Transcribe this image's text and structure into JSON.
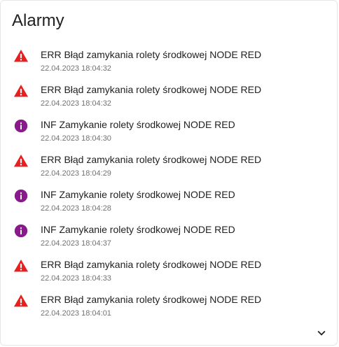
{
  "card": {
    "title": "Alarmy"
  },
  "alarms": [
    {
      "icon": "warning-icon",
      "message": "ERR Błąd zamykania rolety środkowej NODE RED",
      "timestamp": "22.04.2023 18:04:32"
    },
    {
      "icon": "warning-icon",
      "message": "ERR Błąd zamykania rolety środkowej NODE RED",
      "timestamp": "22.04.2023 18:04:32"
    },
    {
      "icon": "info-icon",
      "message": "INF Zamykanie rolety środkowej NODE RED",
      "timestamp": "22.04.2023 18:04:30"
    },
    {
      "icon": "warning-icon",
      "message": "ERR Błąd zamykania rolety środkowej NODE RED",
      "timestamp": "22.04.2023 18:04:29"
    },
    {
      "icon": "info-icon",
      "message": "INF Zamykanie rolety środkowej NODE RED",
      "timestamp": "22.04.2023 18:04:28"
    },
    {
      "icon": "info-icon",
      "message": "INF Zamykanie rolety środkowej NODE RED",
      "timestamp": "22.04.2023 18:04:37"
    },
    {
      "icon": "warning-icon",
      "message": "ERR Błąd zamykania rolety środkowej NODE RED",
      "timestamp": "22.04.2023 18:04:33"
    },
    {
      "icon": "warning-icon",
      "message": "ERR Błąd zamykania rolety środkowej NODE RED",
      "timestamp": "22.04.2023 18:04:01"
    }
  ],
  "expand": {
    "icon": "chevron-down-icon"
  },
  "colors": {
    "error": "#e81f1f",
    "info": "#8a1a8c",
    "text_primary": "#212121",
    "text_secondary": "#727272"
  }
}
